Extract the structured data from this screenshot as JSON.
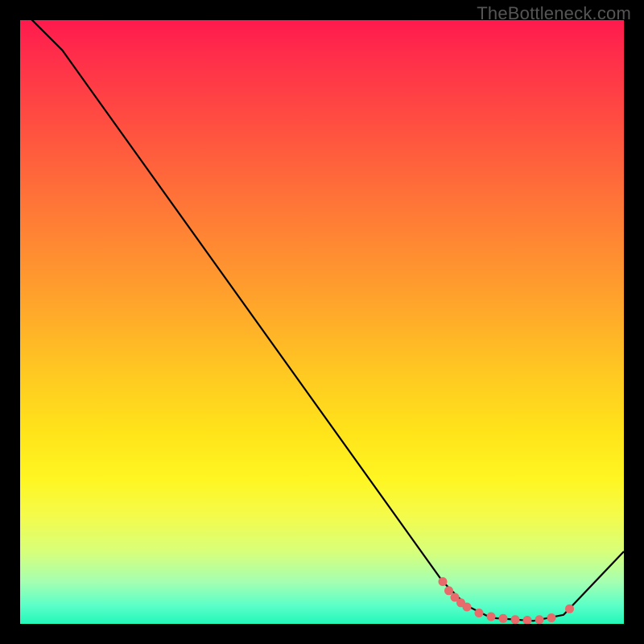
{
  "watermark": "TheBottleneck.com",
  "chart_data": {
    "type": "line",
    "title": "",
    "xlabel": "",
    "ylabel": "",
    "xlim": [
      0,
      100
    ],
    "ylim": [
      0,
      100
    ],
    "curve": [
      {
        "x": 0,
        "y": 102
      },
      {
        "x": 7,
        "y": 95
      },
      {
        "x": 12,
        "y": 88
      },
      {
        "x": 70,
        "y": 7
      },
      {
        "x": 74,
        "y": 3
      },
      {
        "x": 78,
        "y": 1
      },
      {
        "x": 85,
        "y": 0.5
      },
      {
        "x": 90,
        "y": 1.5
      },
      {
        "x": 100,
        "y": 12
      }
    ],
    "markers": [
      {
        "x": 70.0,
        "y": 7.0
      },
      {
        "x": 71.0,
        "y": 5.5
      },
      {
        "x": 72.0,
        "y": 4.4
      },
      {
        "x": 73.0,
        "y": 3.5
      },
      {
        "x": 74.0,
        "y": 2.8
      },
      {
        "x": 76.0,
        "y": 1.8
      },
      {
        "x": 78.0,
        "y": 1.2
      },
      {
        "x": 80.0,
        "y": 0.9
      },
      {
        "x": 82.0,
        "y": 0.7
      },
      {
        "x": 84.0,
        "y": 0.6
      },
      {
        "x": 86.0,
        "y": 0.7
      },
      {
        "x": 88.0,
        "y": 1.0
      },
      {
        "x": 91.0,
        "y": 2.5
      }
    ],
    "marker_color": "#e86a6a",
    "curve_color": "#000000",
    "gradient_stops": [
      {
        "pos": 0,
        "color": "#ff1a4d"
      },
      {
        "pos": 18,
        "color": "#ff5140"
      },
      {
        "pos": 46,
        "color": "#ffa22c"
      },
      {
        "pos": 68,
        "color": "#ffe31a"
      },
      {
        "pos": 88,
        "color": "#d8ff7a"
      },
      {
        "pos": 100,
        "color": "#22f7b8"
      }
    ]
  }
}
